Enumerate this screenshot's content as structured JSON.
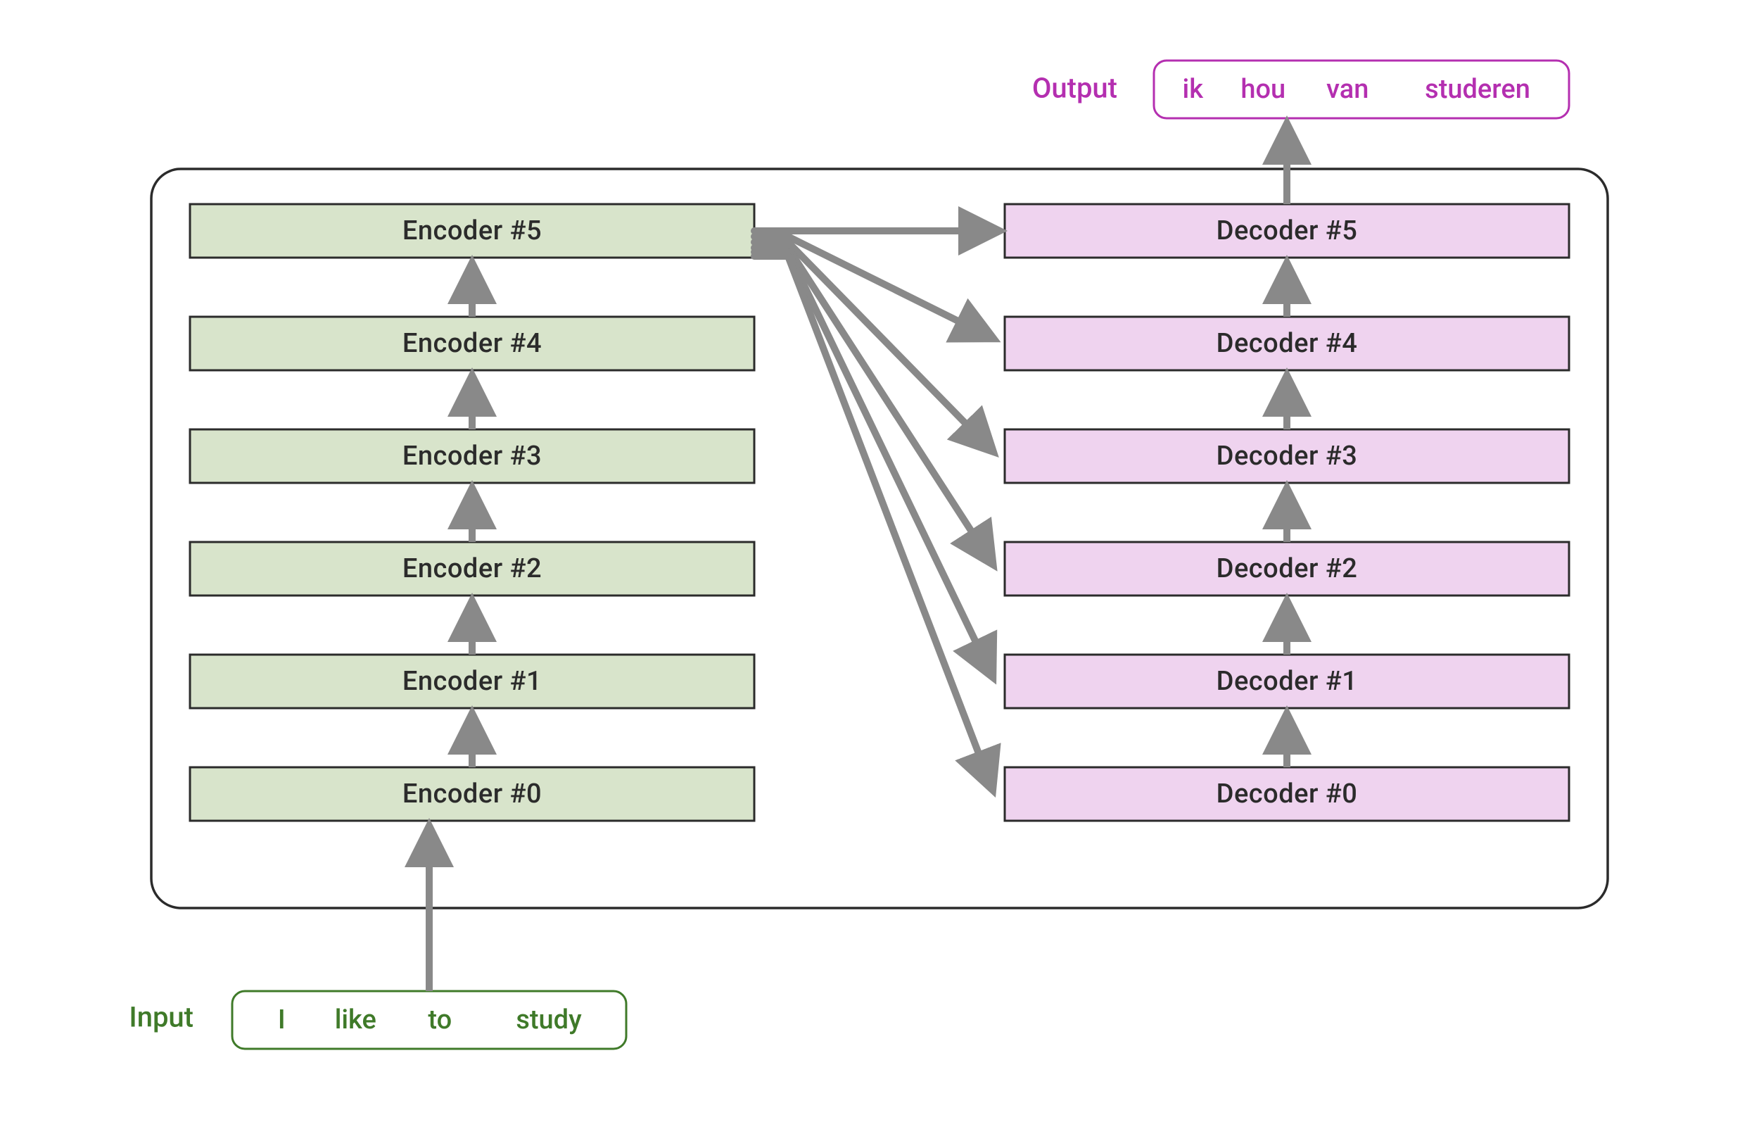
{
  "input": {
    "label": "Input",
    "tokens": [
      "I",
      "like",
      "to",
      "study"
    ],
    "color": "#3f7a29"
  },
  "output": {
    "label": "Output",
    "tokens": [
      "ik",
      "hou",
      "van",
      "studeren"
    ],
    "color": "#b42fb0"
  },
  "encoders": [
    {
      "label": "Encoder #5"
    },
    {
      "label": "Encoder #4"
    },
    {
      "label": "Encoder #3"
    },
    {
      "label": "Encoder #2"
    },
    {
      "label": "Encoder #1"
    },
    {
      "label": "Encoder #0"
    }
  ],
  "decoders": [
    {
      "label": "Decoder #5"
    },
    {
      "label": "Decoder #4"
    },
    {
      "label": "Decoder #3"
    },
    {
      "label": "Decoder #2"
    },
    {
      "label": "Decoder #1"
    },
    {
      "label": "Decoder #0"
    }
  ],
  "colors": {
    "encoderFill": "#d8e4cb",
    "decoderFill": "#efd3ef",
    "blockStroke": "#2b2b2b",
    "arrow": "#898989",
    "containerStroke": "#2b2b2b"
  },
  "chart_data": {
    "type": "diagram",
    "title": "Encoder–Decoder Transformer stack",
    "input_sequence": [
      "I",
      "like",
      "to",
      "study"
    ],
    "output_sequence": [
      "ik",
      "hou",
      "van",
      "studeren"
    ],
    "encoder_layers": 6,
    "decoder_layers": 6,
    "connections": {
      "encoder_stack": "sequential bottom-to-top (#0 → #5)",
      "decoder_stack": "sequential bottom-to-top (#0 → #5)",
      "cross": "Encoder #5 output feeds every Decoder layer (#0–#5)",
      "input_to": "Encoder #0",
      "output_from": "Decoder #5"
    }
  }
}
